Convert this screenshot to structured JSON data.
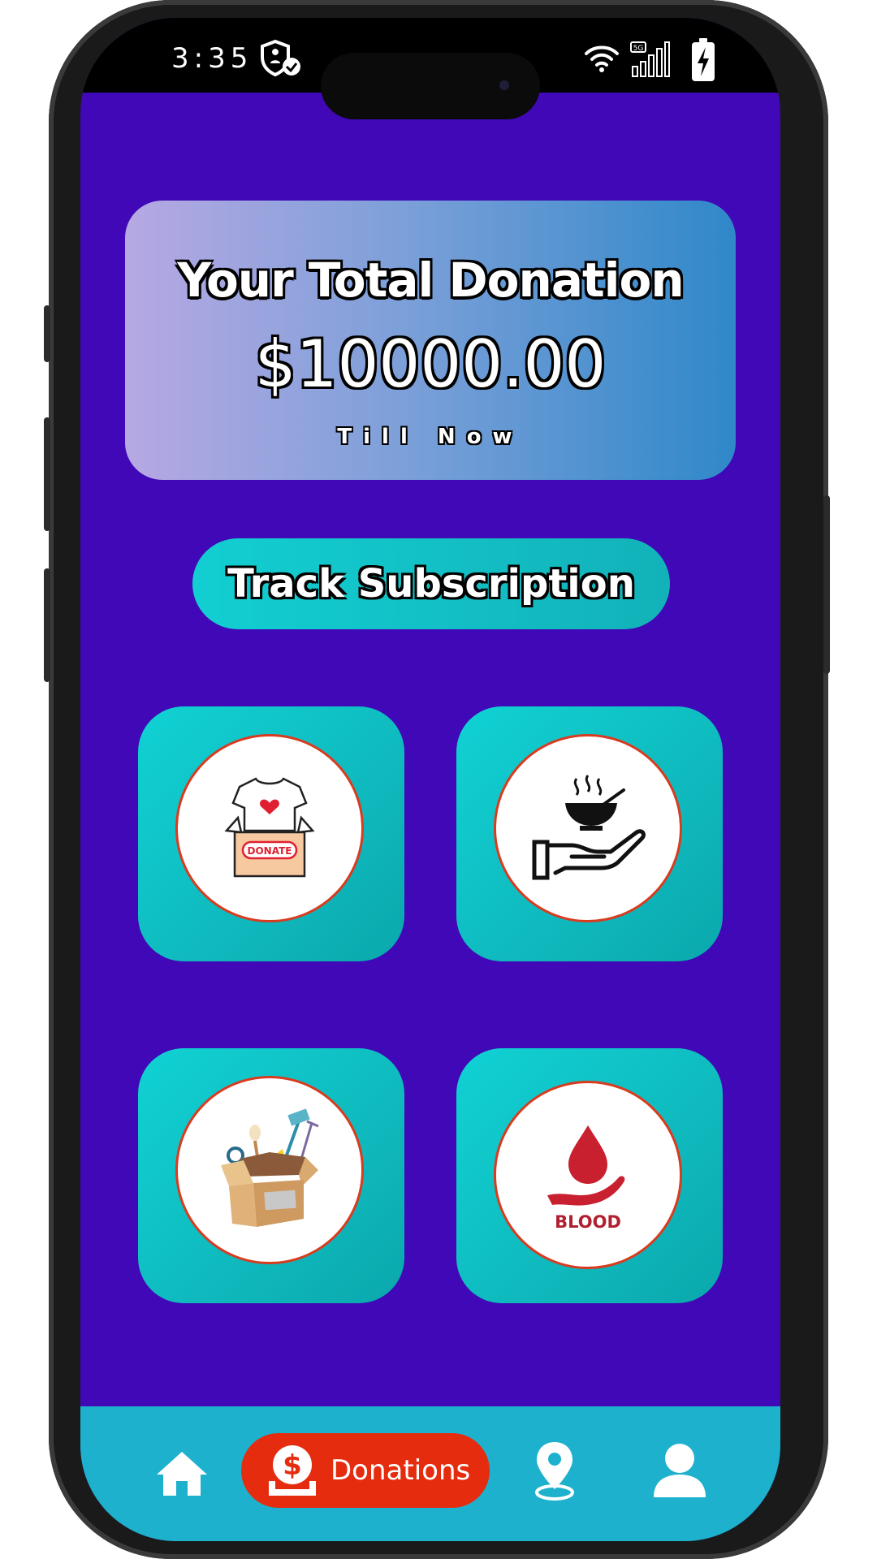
{
  "status_bar": {
    "time": "3:35",
    "icons": [
      "shield-check-icon",
      "wifi-icon",
      "signal-5g-icon",
      "battery-charging-icon"
    ]
  },
  "total_card": {
    "title": "Your Total Donation",
    "amount": "$10000.00",
    "subtitle": "Till Now"
  },
  "track_button": {
    "label": "Track Subscription"
  },
  "tiles": [
    {
      "icon": "clothes-donate-box-icon",
      "badge_text": "DONATE"
    },
    {
      "icon": "food-bowl-hand-icon"
    },
    {
      "icon": "household-items-box-icon"
    },
    {
      "icon": "blood-drop-hand-icon",
      "badge_text": "BLOOD"
    }
  ],
  "bottom_nav": {
    "items": [
      {
        "icon": "home-icon"
      },
      {
        "icon": "donation-dollar-icon",
        "label": "Donations",
        "active": true
      },
      {
        "icon": "location-pin-icon"
      },
      {
        "icon": "user-profile-icon"
      }
    ]
  },
  "colors": {
    "background": "#4008b6",
    "card_gradient_start": "#b7a8e3",
    "card_gradient_end": "#2f88c9",
    "tile": "#10d2d4",
    "nav_bar": "#1eb1cd",
    "nav_active": "#e52c0f",
    "circle_border": "#d93b1f"
  }
}
